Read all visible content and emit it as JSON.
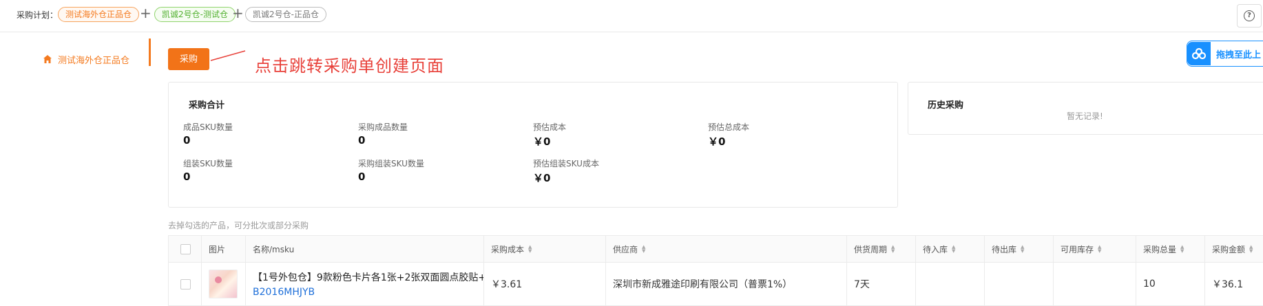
{
  "header": {
    "plan_label": "采购计划：",
    "warehouses": [
      "测试海外仓正品仓",
      "凯诚2号仓-测试仓",
      "凯诚2号仓-正品仓"
    ],
    "plus": "+",
    "help_icon": "question-circle-icon",
    "help_glyph": "?"
  },
  "sidebar": {
    "items": [
      {
        "label": "测试海外仓正品仓",
        "icon": "home-icon"
      }
    ]
  },
  "toolbar": {
    "purchase_label": "采购",
    "annotation": "点击跳转采购单创建页面",
    "drag_label": "拖拽至此上",
    "drag_icon": "cloud-link-icon"
  },
  "summary": {
    "title": "采购合计",
    "stats": [
      {
        "label": "成品SKU数量",
        "value": "0"
      },
      {
        "label": "采购成品数量",
        "value": "0"
      },
      {
        "label": "预估成本",
        "value": "￥0"
      },
      {
        "label": "预估总成本",
        "value": "￥0"
      },
      {
        "label": "组装SKU数量",
        "value": "0"
      },
      {
        "label": "采购组装SKU数量",
        "value": "0"
      },
      {
        "label": "预估组装SKU成本",
        "value": "￥0"
      }
    ]
  },
  "history": {
    "title": "历史采购",
    "empty": "暂无记录!"
  },
  "hint": "去掉勾选的产品，可分批次或部分采购",
  "table": {
    "columns": [
      "图片",
      "名称/msku",
      "采购成本",
      "供应商",
      "供货周期",
      "待入库",
      "待出库",
      "可用库存",
      "采购总量",
      "采购金额"
    ],
    "rows": [
      {
        "name": "【1号外包仓】9款粉色卡片各1张+2张双面圆点胶贴+",
        "msku": "B2016MHJYB",
        "cost": "￥3.61",
        "supplier": "深圳市新成雅途印刷有限公司（普票1%）",
        "cycle": "7天",
        "pending_in": "",
        "pending_out": "",
        "available": "",
        "total_qty": "10",
        "amount": "￥36.1"
      }
    ]
  },
  "colors": {
    "accent": "#f27318",
    "annotation": "#e8413a",
    "link": "#1e6fd9",
    "drag": "#1890ff"
  }
}
